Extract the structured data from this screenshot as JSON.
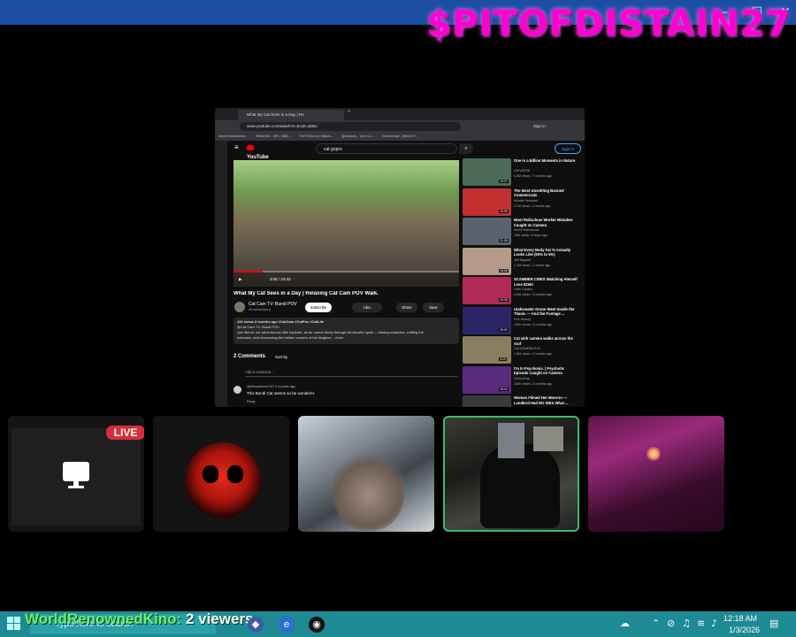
{
  "overlay": {
    "streamer_name": "$PITOFDISTAIN27"
  },
  "window_controls": {
    "minimize": "—",
    "maximize": "☐",
    "close": "✕"
  },
  "browser": {
    "tab_title": "What My Cat Sees in a Day | Re",
    "url": "www.youtube.com/watch?v=bcxE-aDBo",
    "signin": "Sign in",
    "bookmarks": [
      "Import bookmarks...",
      "StrikeOut - NFL, NBA...",
      "TheTVbox.to | Watch...",
      "Spartacus - Your Co...",
      "Streameast - Where S..."
    ]
  },
  "youtube": {
    "logo": "YouTube",
    "search_query": "cat gopro",
    "signin": "Sign in",
    "video": {
      "time": "3:06 / 23:43",
      "progress": 0.13,
      "title": "What My Cat Sees in a Day | Relaxing Cat Cam POV Walk.",
      "channel": "Cat Cam TV: Bundi POV",
      "subscribers": "43 subscribers",
      "subscribe": "Subscribe",
      "like": "Like",
      "share": "Share",
      "save": "Save",
      "desc_line1": "434 views  2 months ago  #CatCam #CatPov #CatLife",
      "desc_line2": "@Cat Cam TV: Bundi POV",
      "desc_line3": "Join Bundi, our adventurous little explorer, as he roams freely through his favorite spots – chasing shadows, sniffing the",
      "desc_line4": "unknown, and uncovering the hidden corners of his kingdom ...more"
    },
    "comments": {
      "count": "2 Comments",
      "sort": "Sort by",
      "add": "Add a comment...",
      "items": [
        {
          "author": "@Killuateinner167  2 months ago",
          "text": "This Bundi Cat seems so be wonderer.",
          "reply": "Reply"
        }
      ]
    },
    "recommendations": [
      {
        "title": "One in a Billion Moments in Nature",
        "channel": "UNIVERSE",
        "meta": "6.5M views • 7 months ago",
        "duration": "19:27",
        "color": "#4c6b58"
      },
      {
        "title": "The Most Unsettling Banned Commercials",
        "channel": "Whistle Ventures",
        "meta": "2.7M views • 3 weeks ago",
        "duration": "15:08",
        "color": "#c23030"
      },
      {
        "title": "Most Ridiculous Worker Mistakes Caught on Camera",
        "channel": "Weird Warehouse",
        "meta": "10M views • 6 days ago",
        "duration": "21:09",
        "color": "#5a6270"
      },
      {
        "title": "What Every Body Fat % Actually Looks Like (50% to 5%)",
        "channel": "Jeff Nippard",
        "meta": "1.1M views • 1 month ago",
        "duration": "16:06",
        "color": "#b59a8a"
      },
      {
        "title": "SCAMMER CRIES Watching Himself Lose $25K!",
        "channel": "Liam Luciano",
        "meta": "6.5M views • 3 months ago",
        "duration": "29:35",
        "color": "#b02a55"
      },
      {
        "title": "Underwater Drone Went Inside the Titanic — And the Footage ...",
        "channel": "Fizz History",
        "meta": "128K views • 2 months ago",
        "duration": "29:00",
        "color": "#2b2566"
      },
      {
        "title": "Cat with camera walks across the roof",
        "channel": "Cat CAMERA POV",
        "meta": "1.5M views • 2 months ago",
        "duration": "4:20",
        "color": "#8a7d60"
      },
      {
        "title": "I'm In Psychosis. | Psychotic Episode Caught on Camera",
        "channel": "SchizoFear",
        "meta": "100K views • 5 months ago",
        "duration": "18:44",
        "color": "#5a2a7e"
      },
      {
        "title": "Woman Filmed Her Move-In — Landlord Had NO IDEA What ...",
        "channel": "",
        "meta": "",
        "duration": "",
        "color": "#3a3a3a"
      }
    ]
  },
  "tiles": {
    "live_badge": "LIVE"
  },
  "taskbar": {
    "search_placeholder": "Type here to search",
    "viewer_name": "WorldRenownedKino",
    "viewer_count": "2 viewers",
    "time": "12:18 AM",
    "date": "1/3/2026"
  }
}
